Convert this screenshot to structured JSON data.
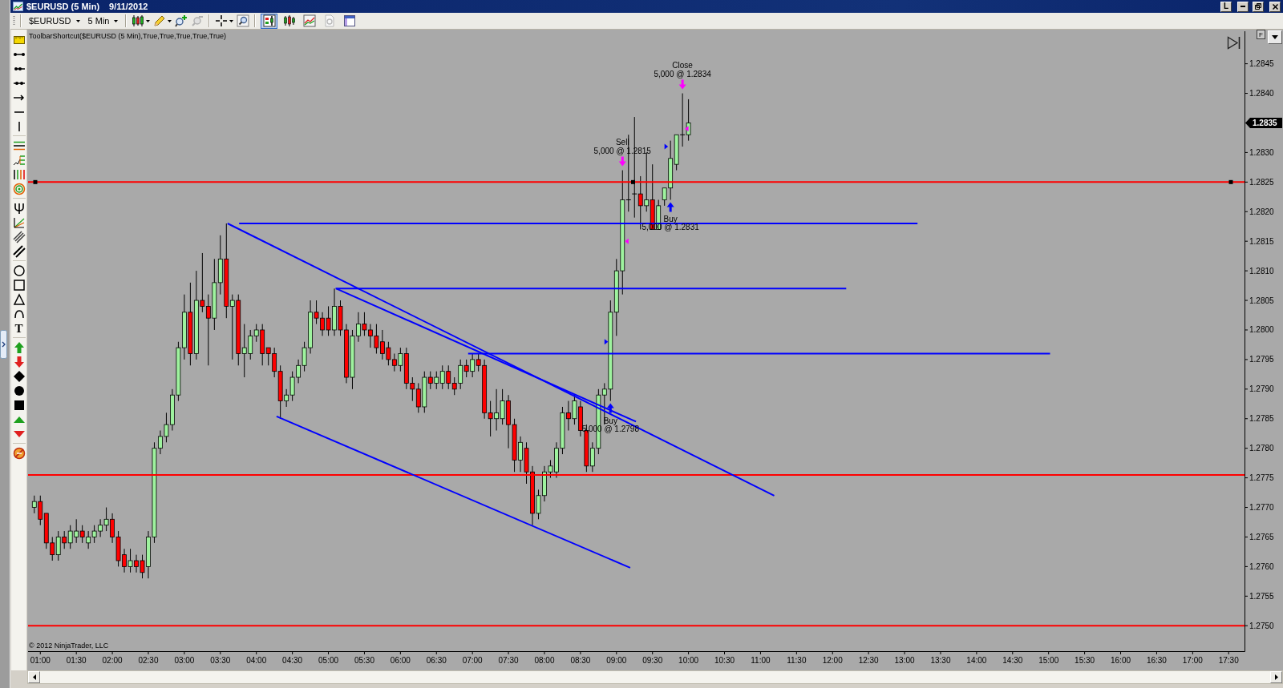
{
  "window": {
    "title": "$EURUSD (5 Min)",
    "date": "9/11/2012",
    "buttons": [
      "L"
    ]
  },
  "toolbar": {
    "instrument": "$EURUSD",
    "interval": "5 Min",
    "zoom": [
      {
        "kind": "zoomin",
        "disabled": false
      },
      {
        "kind": "zoomout",
        "disabled": true
      }
    ],
    "views": [
      {
        "kind": "trader",
        "selected": true,
        "disabled": false
      },
      {
        "kind": "bars",
        "selected": false,
        "disabled": false
      },
      {
        "kind": "lines",
        "selected": false,
        "disabled": false
      },
      {
        "kind": "dollar",
        "selected": false,
        "disabled": true
      },
      {
        "kind": "panel",
        "selected": false,
        "disabled": false
      }
    ]
  },
  "drawing_toolbar": {
    "text_button": "T"
  },
  "chart": {
    "caption": "ToolbarShortcut($EURUSD (5 Min),True,True,True,True,True)",
    "panel_button": "F",
    "copyright": "© 2012 NinjaTrader, LLC",
    "last_price": "1.2835",
    "upper_line_selected": true,
    "trades": [
      {
        "kind": "close",
        "label": "Close",
        "text": "5,000 @ 1.2834"
      },
      {
        "kind": "sell",
        "label": "Sell",
        "text": "5,000 @ 1.2815"
      },
      {
        "kind": "buy",
        "label": "Buy",
        "text": "5,000 @ 1.2831"
      },
      {
        "kind": "buy",
        "label": "Buy",
        "text": "5,000 @ 1.2798"
      }
    ],
    "chart_data": [
      {
        "type": "candlestick",
        "xlim": [
          0.83,
          17.72
        ],
        "ylim": [
          1.27457,
          1.28505
        ],
        "xticks": [
          {
            "value": 1,
            "label": "01:00"
          },
          {
            "value": 1.5,
            "label": "01:30"
          },
          {
            "value": 2,
            "label": "02:00"
          },
          {
            "value": 2.5,
            "label": "02:30"
          },
          {
            "value": 3,
            "label": "03:00"
          },
          {
            "value": 3.5,
            "label": "03:30"
          },
          {
            "value": 4,
            "label": "04:00"
          },
          {
            "value": 4.5,
            "label": "04:30"
          },
          {
            "value": 5,
            "label": "05:00"
          },
          {
            "value": 5.5,
            "label": "05:30"
          },
          {
            "value": 6,
            "label": "06:00"
          },
          {
            "value": 6.5,
            "label": "06:30"
          },
          {
            "value": 7,
            "label": "07:00"
          },
          {
            "value": 7.5,
            "label": "07:30"
          },
          {
            "value": 8,
            "label": "08:00"
          },
          {
            "value": 8.5,
            "label": "08:30"
          },
          {
            "value": 9,
            "label": "09:00"
          },
          {
            "value": 9.5,
            "label": "09:30"
          },
          {
            "value": 10,
            "label": "10:00"
          },
          {
            "value": 10.5,
            "label": "10:30"
          },
          {
            "value": 11,
            "label": "11:00"
          },
          {
            "value": 11.5,
            "label": "11:30"
          },
          {
            "value": 12,
            "label": "12:00"
          },
          {
            "value": 12.5,
            "label": "12:30"
          },
          {
            "value": 13,
            "label": "13:00"
          },
          {
            "value": 13.5,
            "label": "13:30"
          },
          {
            "value": 14,
            "label": "14:00"
          },
          {
            "value": 14.5,
            "label": "14:30"
          },
          {
            "value": 15,
            "label": "15:00"
          },
          {
            "value": 15.5,
            "label": "15:30"
          },
          {
            "value": 16,
            "label": "16:00"
          },
          {
            "value": 16.5,
            "label": "16:30"
          },
          {
            "value": 17,
            "label": "17:00"
          },
          {
            "value": 17.5,
            "label": "17:30"
          }
        ],
        "yticks": [
          {
            "value": 1.275,
            "label": "1.2750"
          },
          {
            "value": 1.2755,
            "label": "1.2755"
          },
          {
            "value": 1.276,
            "label": "1.2760"
          },
          {
            "value": 1.2765,
            "label": "1.2765"
          },
          {
            "value": 1.277,
            "label": "1.2770"
          },
          {
            "value": 1.2775,
            "label": "1.2775"
          },
          {
            "value": 1.278,
            "label": "1.2780"
          },
          {
            "value": 1.2785,
            "label": "1.2785"
          },
          {
            "value": 1.279,
            "label": "1.2790"
          },
          {
            "value": 1.2795,
            "label": "1.2795"
          },
          {
            "value": 1.28,
            "label": "1.2800"
          },
          {
            "value": 1.2805,
            "label": "1.2805"
          },
          {
            "value": 1.281,
            "label": "1.2810"
          },
          {
            "value": 1.2815,
            "label": "1.2815"
          },
          {
            "value": 1.282,
            "label": "1.2820"
          },
          {
            "value": 1.2825,
            "label": "1.2825"
          },
          {
            "value": 1.283,
            "label": "1.2830"
          },
          {
            "value": 1.284,
            "label": "1.2840"
          },
          {
            "value": 1.2845,
            "label": "1.2845"
          }
        ],
        "x": [
          0.9167,
          1,
          1.0833,
          1.1667,
          1.25,
          1.3333,
          1.4167,
          1.5,
          1.5833,
          1.6667,
          1.75,
          1.8333,
          1.9167,
          2,
          2.0833,
          2.1667,
          2.25,
          2.3333,
          2.4167,
          2.5,
          2.5833,
          2.6667,
          2.75,
          2.8333,
          2.9167,
          3,
          3.0833,
          3.1667,
          3.25,
          3.3333,
          3.4167,
          3.5,
          3.5833,
          3.6667,
          3.75,
          3.8333,
          3.9167,
          4,
          4.0833,
          4.1667,
          4.25,
          4.3333,
          4.4167,
          4.5,
          4.5833,
          4.6667,
          4.75,
          4.8333,
          4.9167,
          5,
          5.0833,
          5.1667,
          5.25,
          5.3333,
          5.4167,
          5.5,
          5.5833,
          5.6667,
          5.75,
          5.8333,
          5.9167,
          6,
          6.0833,
          6.1667,
          6.25,
          6.3333,
          6.4167,
          6.5,
          6.5833,
          6.6667,
          6.75,
          6.8333,
          6.9167,
          7,
          7.0833,
          7.1667,
          7.25,
          7.3333,
          7.4167,
          7.5,
          7.5833,
          7.6667,
          7.75,
          7.8333,
          7.9167,
          8,
          8.0833,
          8.1667,
          8.25,
          8.3333,
          8.4167,
          8.5,
          8.5833,
          8.6667,
          8.75,
          8.8333,
          8.9167,
          9,
          9.0833,
          9.1667,
          9.25,
          9.3333,
          9.4167,
          9.5,
          9.5833,
          9.6667,
          9.75,
          9.8333,
          9.9167,
          10
        ],
        "ohlc": [
          [
            1.277,
            1.2772,
            1.2769,
            1.2771
          ],
          [
            1.2771,
            1.2772,
            1.2767,
            1.2768
          ],
          [
            1.2769,
            1.2769,
            1.2763,
            1.2764
          ],
          [
            1.2764,
            1.2765,
            1.2761,
            1.2762
          ],
          [
            1.2762,
            1.2766,
            1.2761,
            1.2765
          ],
          [
            1.2765,
            1.2766,
            1.2763,
            1.2764
          ],
          [
            1.2764,
            1.2767,
            1.2763,
            1.2766
          ],
          [
            1.2765,
            1.2768,
            1.2764,
            1.2766
          ],
          [
            1.2766,
            1.2767,
            1.2764,
            1.2765
          ],
          [
            1.2764,
            1.2766,
            1.2763,
            1.2765
          ],
          [
            1.2765,
            1.2767,
            1.2764,
            1.2766
          ],
          [
            1.2766,
            1.2768,
            1.2765,
            1.2767
          ],
          [
            1.2767,
            1.277,
            1.2766,
            1.2768
          ],
          [
            1.2768,
            1.2769,
            1.2764,
            1.2765
          ],
          [
            1.2765,
            1.2766,
            1.276,
            1.2761
          ],
          [
            1.2762,
            1.2763,
            1.2759,
            1.276
          ],
          [
            1.276,
            1.2763,
            1.2759,
            1.2761
          ],
          [
            1.2761,
            1.2762,
            1.2759,
            1.276
          ],
          [
            1.2761,
            1.2762,
            1.2758,
            1.2759
          ],
          [
            1.276,
            1.2766,
            1.2758,
            1.2765
          ],
          [
            1.2765,
            1.2781,
            1.2764,
            1.278
          ],
          [
            1.278,
            1.2783,
            1.2779,
            1.2782
          ],
          [
            1.2782,
            1.2786,
            1.2781,
            1.2784
          ],
          [
            1.2784,
            1.279,
            1.2783,
            1.2789
          ],
          [
            1.2789,
            1.2798,
            1.2788,
            1.2797
          ],
          [
            1.2797,
            1.2806,
            1.2795,
            1.2803
          ],
          [
            1.2803,
            1.2808,
            1.2794,
            1.2796
          ],
          [
            1.2796,
            1.281,
            1.2795,
            1.2805
          ],
          [
            1.2805,
            1.2813,
            1.2803,
            1.2804
          ],
          [
            1.2804,
            1.2806,
            1.2794,
            1.2802
          ],
          [
            1.2802,
            1.2812,
            1.28,
            1.2808
          ],
          [
            1.2808,
            1.2816,
            1.2806,
            1.2812
          ],
          [
            1.2812,
            1.2818,
            1.2802,
            1.2804
          ],
          [
            1.2804,
            1.2806,
            1.2795,
            1.2805
          ],
          [
            1.2805,
            1.2806,
            1.2794,
            1.2796
          ],
          [
            1.2796,
            1.2801,
            1.2792,
            1.2797
          ],
          [
            1.2796,
            1.28,
            1.2795,
            1.2799
          ],
          [
            1.2799,
            1.2801,
            1.2798,
            1.28
          ],
          [
            1.28,
            1.2801,
            1.2794,
            1.2796
          ],
          [
            1.2797,
            1.2797,
            1.2794,
            1.2796
          ],
          [
            1.2796,
            1.2797,
            1.2792,
            1.2793
          ],
          [
            1.2793,
            1.2794,
            1.2785,
            1.2788
          ],
          [
            1.2788,
            1.279,
            1.2787,
            1.2789
          ],
          [
            1.2789,
            1.2793,
            1.2788,
            1.2792
          ],
          [
            1.2792,
            1.2795,
            1.2791,
            1.2794
          ],
          [
            1.2794,
            1.2798,
            1.2793,
            1.2797
          ],
          [
            1.2797,
            1.2805,
            1.2796,
            1.2803
          ],
          [
            1.2803,
            1.2805,
            1.2801,
            1.2802
          ],
          [
            1.2802,
            1.2803,
            1.2799,
            1.28
          ],
          [
            1.2802,
            1.2804,
            1.2799,
            1.28
          ],
          [
            1.28,
            1.2807,
            1.2799,
            1.2804
          ],
          [
            1.2804,
            1.2805,
            1.2799,
            1.28
          ],
          [
            1.28,
            1.2801,
            1.2791,
            1.2792
          ],
          [
            1.2792,
            1.28,
            1.279,
            1.2799
          ],
          [
            1.2799,
            1.2803,
            1.2798,
            1.2801
          ],
          [
            1.2801,
            1.2803,
            1.2799,
            1.28
          ],
          [
            1.28,
            1.2801,
            1.2797,
            1.2799
          ],
          [
            1.2799,
            1.2801,
            1.2796,
            1.2797
          ],
          [
            1.2798,
            1.28,
            1.2795,
            1.2796
          ],
          [
            1.2797,
            1.2798,
            1.2794,
            1.2795
          ],
          [
            1.2795,
            1.2796,
            1.2793,
            1.2794
          ],
          [
            1.2794,
            1.2797,
            1.2793,
            1.2796
          ],
          [
            1.2796,
            1.2797,
            1.279,
            1.2791
          ],
          [
            1.2791,
            1.2792,
            1.2788,
            1.279
          ],
          [
            1.279,
            1.2791,
            1.2786,
            1.2787
          ],
          [
            1.2787,
            1.2793,
            1.2786,
            1.2792
          ],
          [
            1.2792,
            1.2793,
            1.279,
            1.2791
          ],
          [
            1.2791,
            1.2793,
            1.279,
            1.2792
          ],
          [
            1.2791,
            1.2794,
            1.279,
            1.2793
          ],
          [
            1.2793,
            1.2794,
            1.279,
            1.2791
          ],
          [
            1.2791,
            1.2792,
            1.2789,
            1.279
          ],
          [
            1.2791,
            1.2795,
            1.279,
            1.2794
          ],
          [
            1.2794,
            1.2795,
            1.2792,
            1.2793
          ],
          [
            1.2793,
            1.2796,
            1.2792,
            1.2795
          ],
          [
            1.2795,
            1.2796,
            1.2793,
            1.2794
          ],
          [
            1.2794,
            1.2795,
            1.2785,
            1.2786
          ],
          [
            1.2786,
            1.2788,
            1.2782,
            1.2785
          ],
          [
            1.2785,
            1.279,
            1.2783,
            1.2786
          ],
          [
            1.2785,
            1.279,
            1.2784,
            1.2788
          ],
          [
            1.2788,
            1.2789,
            1.278,
            1.2784
          ],
          [
            1.2784,
            1.2785,
            1.2776,
            1.2778
          ],
          [
            1.2778,
            1.2782,
            1.2776,
            1.2781
          ],
          [
            1.278,
            1.2781,
            1.2774,
            1.2776
          ],
          [
            1.2776,
            1.2777,
            1.2767,
            1.2769
          ],
          [
            1.2769,
            1.2773,
            1.2768,
            1.2772
          ],
          [
            1.2772,
            1.2777,
            1.2771,
            1.2776
          ],
          [
            1.2776,
            1.2778,
            1.2775,
            1.2777
          ],
          [
            1.2776,
            1.2781,
            1.2775,
            1.278
          ],
          [
            1.278,
            1.2787,
            1.2779,
            1.2786
          ],
          [
            1.2786,
            1.2788,
            1.2783,
            1.2785
          ],
          [
            1.2785,
            1.2789,
            1.2784,
            1.2788
          ],
          [
            1.2787,
            1.2788,
            1.2782,
            1.2783
          ],
          [
            1.2783,
            1.2784,
            1.2776,
            1.2777
          ],
          [
            1.2777,
            1.2781,
            1.2776,
            1.278
          ],
          [
            1.278,
            1.279,
            1.2779,
            1.2789
          ],
          [
            1.2789,
            1.2791,
            1.2784,
            1.279
          ],
          [
            1.279,
            1.2805,
            1.2788,
            1.2803
          ],
          [
            1.2803,
            1.2812,
            1.2799,
            1.281
          ],
          [
            1.281,
            1.2827,
            1.2806,
            1.2822
          ],
          [
            1.2822,
            1.2833,
            1.282,
            1.2822
          ],
          [
            1.2823,
            1.2836,
            1.2819,
            1.2823
          ],
          [
            1.2823,
            1.2826,
            1.2817,
            1.2821
          ],
          [
            1.2821,
            1.283,
            1.282,
            1.2822
          ],
          [
            1.2822,
            1.2828,
            1.2817,
            1.2817
          ],
          [
            1.2817,
            1.2822,
            1.2817,
            1.2821
          ],
          [
            1.2822,
            1.2824,
            1.2821,
            1.2824
          ],
          [
            1.2824,
            1.2832,
            1.2822,
            1.2829
          ],
          [
            1.2828,
            1.2833,
            1.2827,
            1.2833
          ],
          [
            1.2833,
            1.284,
            1.2831,
            1.2833
          ],
          [
            1.2833,
            1.2839,
            1.2832,
            1.2835
          ]
        ],
        "series": [
          {
            "type": "line",
            "color": "#0000ff",
            "x": [
              3.76,
              13.18
            ],
            "values": [
              1.2818,
              1.2818
            ]
          },
          {
            "type": "line",
            "color": "#0000ff",
            "x": [
              3.6,
              11.19
            ],
            "values": [
              1.2818,
              1.2772
            ]
          },
          {
            "type": "line",
            "color": "#0000ff",
            "x": [
              5.1,
              12.19
            ],
            "values": [
              1.2807,
              1.2807
            ]
          },
          {
            "type": "line",
            "color": "#0000ff",
            "x": [
              5.11,
              9.27
            ],
            "values": [
              1.2807,
              1.27845
            ]
          },
          {
            "type": "line",
            "color": "#0000ff",
            "x": [
              6.94,
              15.02
            ],
            "values": [
              1.2796,
              1.2796
            ]
          },
          {
            "type": "line",
            "color": "#0000ff",
            "x": [
              4.28,
              9.19
            ],
            "values": [
              1.27854,
              1.27598
            ]
          },
          {
            "type": "scatter",
            "color": "#ff00ff",
            "marker": "triangle-left",
            "x": [
              9.9167,
              9.0833
            ],
            "values": [
              1.2834,
              1.2815
            ]
          },
          {
            "type": "scatter",
            "color": "#0000ff",
            "marker": "triangle-right",
            "x": [
              9.75,
              8.9167
            ],
            "values": [
              1.2831,
              1.2798
            ]
          }
        ],
        "ref_lines": [
          {
            "axis": "y",
            "value": 1.2825,
            "color": "#ff0000"
          },
          {
            "axis": "y",
            "value": 1.27755,
            "color": "#ff0000"
          },
          {
            "axis": "y",
            "value": 1.275,
            "color": "#ff0000"
          }
        ]
      }
    ]
  }
}
